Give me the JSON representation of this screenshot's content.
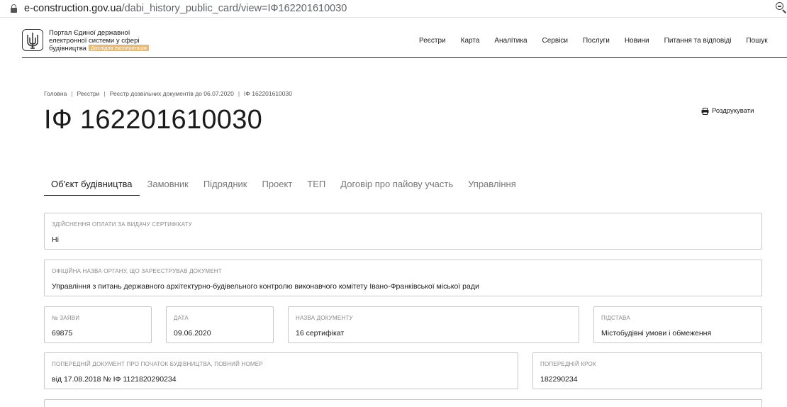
{
  "browser": {
    "url_domain": "e-construction.gov.ua",
    "url_path": "/dabi_history_public_card/view=ІФ162201610030"
  },
  "header": {
    "portal_line1": "Портал Єдиної державної",
    "portal_line2": "електронної системи у сфері",
    "portal_line3": "будівництва",
    "badge": "Дослідна експлуатація",
    "nav": [
      "Реєстри",
      "Карта",
      "Аналітика",
      "Сервіси",
      "Послуги",
      "Новини",
      "Питання та відповіді",
      "Пошук"
    ]
  },
  "breadcrumb": [
    "Головна",
    "Реєстри",
    "Реєстр дозвільних документів до 06.07.2020",
    "ІФ 162201610030"
  ],
  "page_title": "ІФ 162201610030",
  "print_label": "Роздрукувати",
  "tabs": [
    "Об'єкт будівництва",
    "Замовник",
    "Підрядник",
    "Проект",
    "ТЕП",
    "Договір про пайову участь",
    "Управління"
  ],
  "fields": {
    "payment": {
      "label": "Здійснення оплати за видачу сертифікату",
      "value": "Ні"
    },
    "organ": {
      "label": "Офіційна назва органу, що зареєстрував документ",
      "value": "Управління з питань державного архітектурно-будівельного контролю виконавчого комітету Івано-Франківської міської ради"
    },
    "app_no": {
      "label": "№ заяви",
      "value": "69875"
    },
    "date": {
      "label": "Дата",
      "value": "09.06.2020"
    },
    "doc_name": {
      "label": "Назва документу",
      "value": "16 сертифікат"
    },
    "basis": {
      "label": "Підстава",
      "value": "Містобудівні умови і обмеження"
    },
    "prev_doc": {
      "label": "Попередній документ про початок будівництва, повний номер",
      "value": "від 17.08.2018 № ІФ 1121820290234"
    },
    "prev_step": {
      "label": "Попередній крок",
      "value": "182290234"
    }
  }
}
